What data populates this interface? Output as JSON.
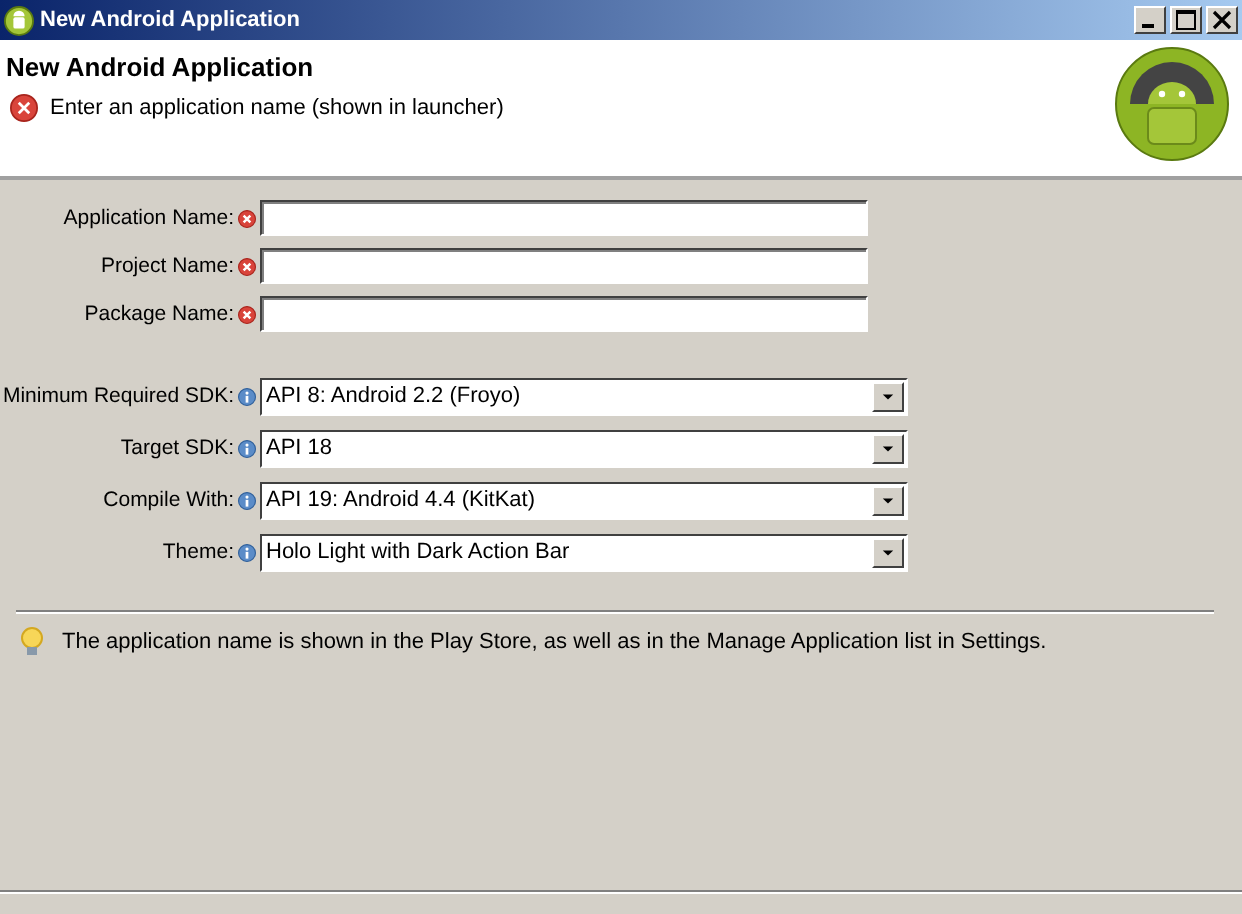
{
  "window": {
    "title": "New Android Application"
  },
  "header": {
    "title": "New Android Application",
    "message": "Enter an application name (shown in launcher)",
    "error": true
  },
  "form_groups": [
    {
      "fields": [
        {
          "label": "Application Name:",
          "kind": "text",
          "error": true
        },
        {
          "label": "Project Name:",
          "kind": "text",
          "error": true
        },
        {
          "label": "Package Name:",
          "kind": "text",
          "error": true
        }
      ]
    },
    {
      "fields": [
        {
          "label": "Minimum Required SDK:",
          "kind": "combo",
          "error": false,
          "value": "API 8: Android 2.2 (Froyo)"
        },
        {
          "label": "Target SDK:",
          "kind": "combo",
          "error": false,
          "value": "API 18"
        },
        {
          "label": "Compile With:",
          "kind": "combo",
          "error": false,
          "value": "API 19: Android 4.4 (KitKat)"
        },
        {
          "label": "Theme:",
          "kind": "combo",
          "error": false,
          "value": "Holo Light with Dark Action Bar"
        }
      ]
    }
  ],
  "hint": "The application name is shown in the Play Store, as well as in the Manage Application list in Settings."
}
